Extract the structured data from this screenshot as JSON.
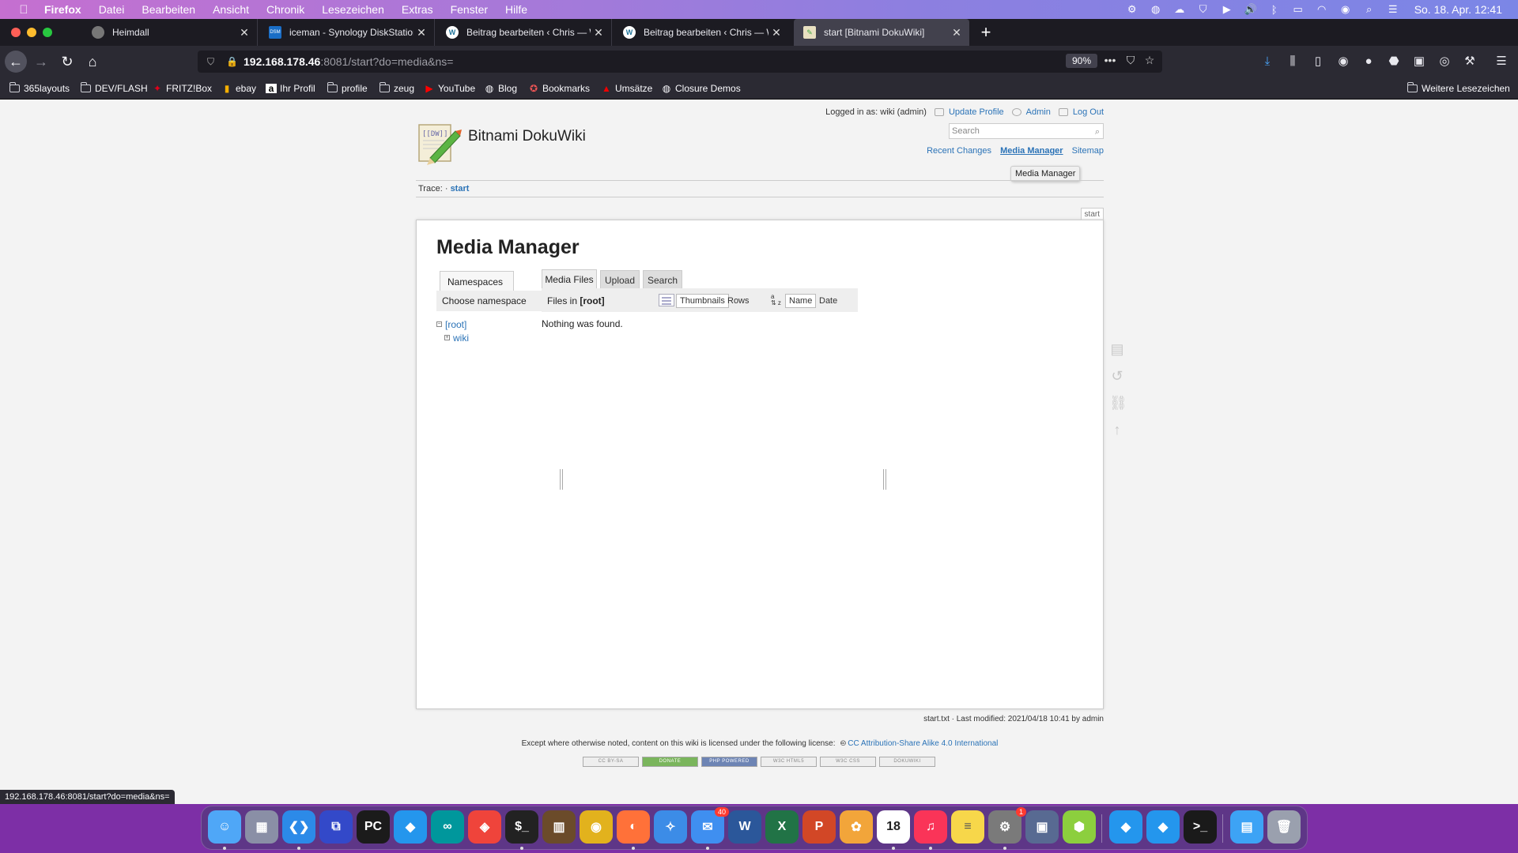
{
  "menubar": {
    "app_name": "Firefox",
    "menus": [
      "Datei",
      "Bearbeiten",
      "Ansicht",
      "Chronik",
      "Lesezeichen",
      "Extras",
      "Fenster",
      "Hilfe"
    ],
    "clock": "So. 18. Apr.  12:41"
  },
  "tabs": [
    {
      "title": "Heimdall",
      "favicon": "globe-icon"
    },
    {
      "title": "iceman - Synology DiskStation",
      "favicon_text": "DSM"
    },
    {
      "title": "Beitrag bearbeiten ‹ Chris — W",
      "favicon": "wordpress-icon"
    },
    {
      "title": "Beitrag bearbeiten ‹ Chris — W",
      "favicon": "wordpress-icon"
    },
    {
      "title": "start [Bitnami DokuWiki]",
      "favicon": "dokuwiki-icon"
    }
  ],
  "navbar": {
    "url_host": "192.168.178.46",
    "url_rest": ":8081/start?do=media&ns=",
    "zoom": "90%",
    "more_glyph": "•••"
  },
  "bookmarks": [
    {
      "label": "365layouts",
      "icon": "folder-icon"
    },
    {
      "label": "DEV/FLASH",
      "icon": "folder-icon"
    },
    {
      "label": "FRITZ!Box",
      "icon": "fritzbox-icon"
    },
    {
      "label": "ebay",
      "icon": "ebay-icon"
    },
    {
      "label": "Ihr Profil",
      "icon": "amazon-icon"
    },
    {
      "label": "profile",
      "icon": "folder-icon"
    },
    {
      "label": "zeug",
      "icon": "folder-icon"
    },
    {
      "label": "YouTube",
      "icon": "youtube-icon"
    },
    {
      "label": "Blog",
      "icon": "globe-icon"
    },
    {
      "label": "Bookmarks",
      "icon": "bookmark-icon"
    },
    {
      "label": "Umsätze",
      "icon": "bank-icon"
    },
    {
      "label": "Closure Demos",
      "icon": "globe-icon"
    }
  ],
  "bookmarks_more": "Weitere Lesezeichen",
  "wiki": {
    "logo_text": "[[DW]]",
    "title": "Bitnami DokuWiki",
    "logged_in": "Logged in as: wiki (admin)",
    "user_links": [
      "Update Profile",
      "Admin",
      "Log Out"
    ],
    "search_placeholder": "Search",
    "top_links": [
      "Recent Changes",
      "Media Manager",
      "Sitemap"
    ],
    "tooltip": "Media Manager",
    "trace_label": "Trace:",
    "trace_sep": "·",
    "trace_link": "start",
    "page_id": "start",
    "heading": "Media Manager",
    "namespaces_tab": "Namespaces",
    "choose_namespace": "Choose namespace",
    "tree": {
      "root": "[root]",
      "child": "wiki"
    },
    "file_tabs": [
      "Media Files",
      "Upload",
      "Search"
    ],
    "files_in_label": "Files in",
    "files_in_ns": "[root]",
    "view_buttons": [
      "Thumbnails",
      "Rows"
    ],
    "sort_buttons": [
      "Name",
      "Date"
    ],
    "sort_glyph_top": "a",
    "sort_glyph_bottom": "⇅ z",
    "empty_message": "Nothing was found.",
    "docinfo": "start.txt · Last modified: 2021/04/18 10:41 by admin",
    "license_text": "Except where otherwise noted, content on this wiki is licensed under the following license:",
    "license_link": "CC Attribution-Share Alike 4.0 International",
    "badges": [
      "CC BY-SA",
      "DONATE",
      "PHP POWERED",
      "W3C HTML5",
      "W3C CSS",
      "DOKUWIKI"
    ]
  },
  "status_url": "192.168.178.46:8081/start?do=media&ns=",
  "dock": {
    "apps": [
      {
        "name": "finder-icon",
        "glyph": "☺",
        "color": "#4fa7f7"
      },
      {
        "name": "launchpad-icon",
        "glyph": "▦",
        "color": "#8a8fa6"
      },
      {
        "name": "vscode-icon",
        "glyph": "❮❯",
        "color": "#2c8ae8"
      },
      {
        "name": "remote-icon",
        "glyph": "⧉",
        "color": "#3349c9"
      },
      {
        "name": "pycharm-icon",
        "glyph": "PC",
        "color": "#1b1b1b"
      },
      {
        "name": "docker-icon",
        "glyph": "◆",
        "color": "#2496ed"
      },
      {
        "name": "arduino-icon",
        "glyph": "∞",
        "color": "#00979c"
      },
      {
        "name": "anydesk-icon",
        "glyph": "◈",
        "color": "#ef443b"
      },
      {
        "name": "terminal-icon",
        "glyph": "$_",
        "color": "#222222"
      },
      {
        "name": "calibre-icon",
        "glyph": "▥",
        "color": "#6b4b2a"
      },
      {
        "name": "chrome-icon",
        "glyph": "◉",
        "color": "#e2b21d"
      },
      {
        "name": "firefox-icon",
        "glyph": "◐",
        "color": "#ff7139"
      },
      {
        "name": "safari-icon",
        "glyph": "✧",
        "color": "#3c8ce7"
      },
      {
        "name": "mail-icon",
        "glyph": "✉",
        "color": "#3f8ff0",
        "badge": "40"
      },
      {
        "name": "word-icon",
        "glyph": "W",
        "color": "#2b579a"
      },
      {
        "name": "excel-icon",
        "glyph": "X",
        "color": "#217346"
      },
      {
        "name": "powerpoint-icon",
        "glyph": "P",
        "color": "#d24726"
      },
      {
        "name": "photos-icon",
        "glyph": "✿",
        "color": "#f2a53a"
      },
      {
        "name": "calendar-icon",
        "glyph": "18",
        "color": "#ffffff"
      },
      {
        "name": "music-icon",
        "glyph": "♫",
        "color": "#fa3458"
      },
      {
        "name": "notes-icon",
        "glyph": "≡",
        "color": "#f7d74a"
      },
      {
        "name": "system-preferences-icon",
        "glyph": "⚙",
        "color": "#7a7a7a",
        "badge": "1"
      },
      {
        "name": "preview-icon",
        "glyph": "▣",
        "color": "#586a92"
      },
      {
        "name": "cube-icon",
        "glyph": "⬢",
        "color": "#8ccf3e"
      },
      {
        "name": "docker-2-icon",
        "glyph": "◆",
        "color": "#2496ed"
      },
      {
        "name": "docker-3-icon",
        "glyph": "◆",
        "color": "#2496ed"
      },
      {
        "name": "terminal-2-icon",
        "glyph": ">_",
        "color": "#1a1a1a"
      },
      {
        "name": "downloads-folder-icon",
        "glyph": "▤",
        "color": "#3da3f5"
      },
      {
        "name": "trash-icon",
        "glyph": "🗑",
        "color": "#9aa0ae"
      }
    ]
  },
  "colors": {
    "link": "#2b73b7",
    "menubar_gradient_start": "#c56fd0",
    "menubar_gradient_end": "#7b86e6",
    "browser_dark": "#2b2a33",
    "dock_background": "#7d2fa6"
  }
}
